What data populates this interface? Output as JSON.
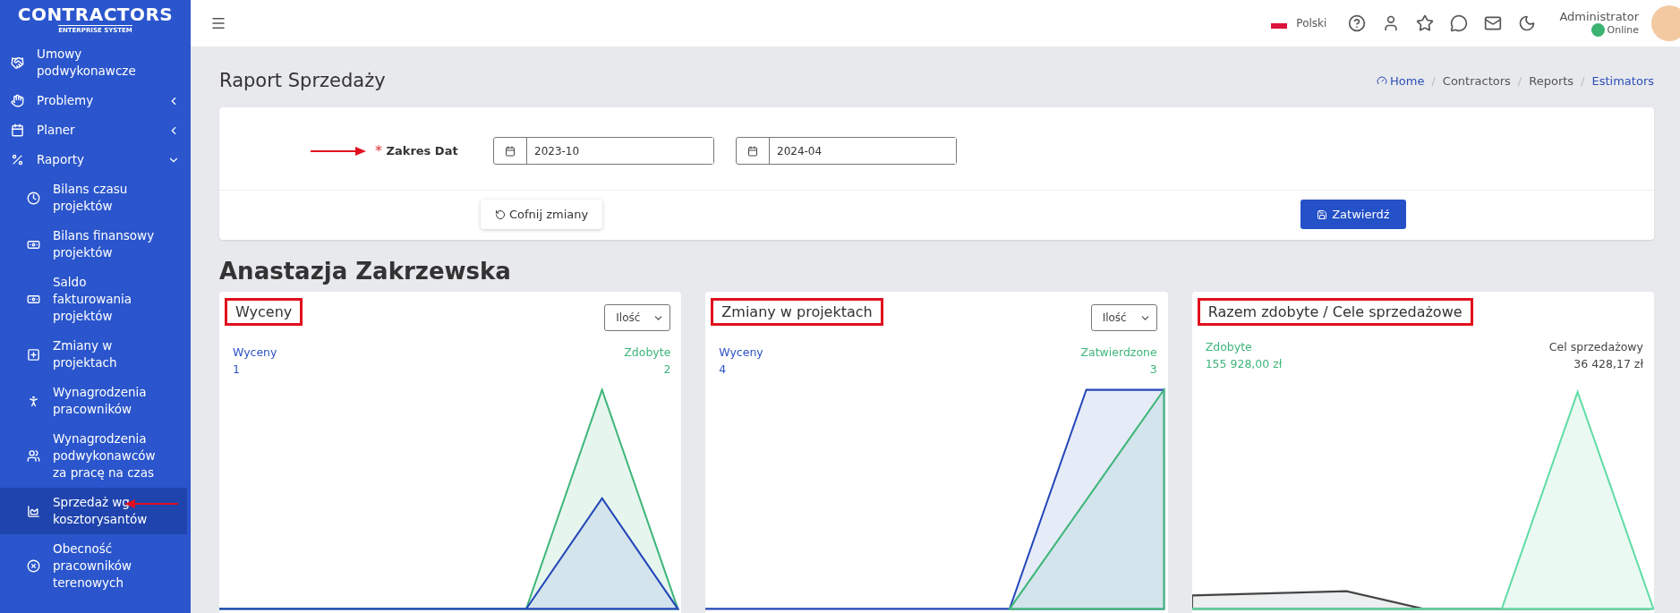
{
  "sidebar": {
    "logo": {
      "title": "CONTRACTORS",
      "subtitle": "ENTERPRISE SYSTEM"
    },
    "items": [
      {
        "kind": "top",
        "label": "Umowy podwykonawcze",
        "selected": false
      },
      {
        "kind": "group",
        "label": "Problemy",
        "expanded": false,
        "selected": false
      },
      {
        "kind": "group",
        "label": "Planer",
        "expanded": false,
        "selected": false
      },
      {
        "kind": "group",
        "label": "Raporty",
        "expanded": true,
        "selected": false,
        "children": [
          {
            "label": "Bilans czasu projektów",
            "selected": false,
            "marked": false
          },
          {
            "label": "Bilans finansowy projektów",
            "selected": false,
            "marked": false
          },
          {
            "label": "Saldo fakturowania projektów",
            "selected": false,
            "marked": false
          },
          {
            "label": "Zmiany w projektach",
            "selected": false,
            "marked": false
          },
          {
            "label": "Wynagrodzenia pracowników",
            "selected": false,
            "marked": false
          },
          {
            "label": "Wynagrodzenia podwykonawców za pracę na czas",
            "selected": false,
            "marked": false
          },
          {
            "label": "Sprzedaż wg kosztorysantów",
            "selected": true,
            "marked": true
          },
          {
            "label": "Obecność pracowników terenowych",
            "selected": false,
            "marked": false
          }
        ]
      }
    ]
  },
  "header": {
    "language": "Polski",
    "user": {
      "name": "Administrator",
      "status": "Online"
    }
  },
  "page": {
    "title": "Raport Sprzedaży",
    "separator": "/",
    "breadcrumb": [
      {
        "label": "Home",
        "link": true
      },
      {
        "label": "Contractors",
        "link": false
      },
      {
        "label": "Reports",
        "link": false
      },
      {
        "label": "Estimators",
        "link": true
      }
    ]
  },
  "form": {
    "label": "Zakres Dat",
    "required_mark": "*",
    "marked": true,
    "from": "2023-10",
    "to": "2024-04",
    "reset": "Cofnij zmiany",
    "submit": "Zatwierdź"
  },
  "person": "Anastazja Zakrzewska",
  "cards": [
    {
      "title": "Wyceny",
      "highlighted": true,
      "select": "Ilość",
      "legend": [
        {
          "label": "Wyceny",
          "value": "1",
          "color": "#2d52c4"
        },
        {
          "label": "Zdobyte",
          "value": "2",
          "color": "#3fb67a"
        }
      ]
    },
    {
      "title": "Zmiany w projektach",
      "highlighted": true,
      "select": "Ilość",
      "legend": [
        {
          "label": "Wyceny",
          "value": "4",
          "color": "#2d52c4"
        },
        {
          "label": "Zatwierdzone",
          "value": "3",
          "color": "#3fb67a"
        }
      ]
    },
    {
      "title": "Razem zdobyte / Cele sprzedażowe",
      "highlighted": true,
      "legend": [
        {
          "label": "Zdobyte",
          "value": "155 928,00 zł",
          "color": "#3fb67a"
        },
        {
          "label": "Cel sprzedażowy",
          "value": "36 428,17 zł",
          "color": "#444444"
        }
      ]
    }
  ]
}
